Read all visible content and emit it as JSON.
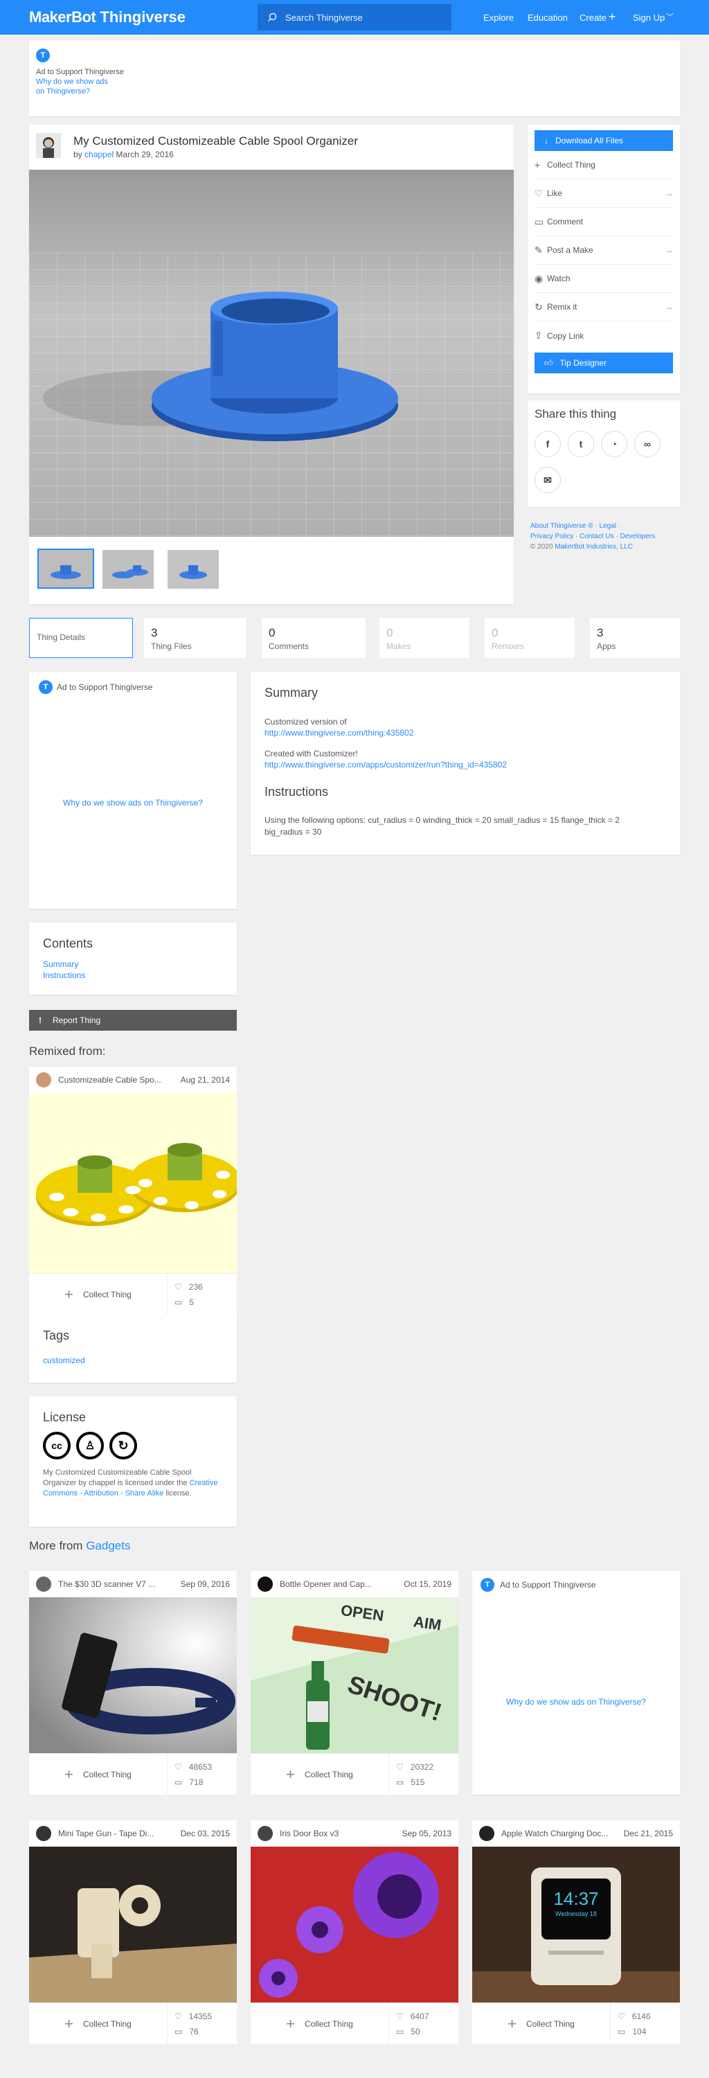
{
  "header": {
    "logo_maker": "MakerBot",
    "logo_thing": "Thingiverse",
    "search_placeholder": "Search Thingiverse",
    "nav": [
      "Explore",
      "Education",
      "Create",
      "Sign Up"
    ]
  },
  "ad_top": {
    "title": "Ad to Support Thingiverse",
    "why_1": "Why do we show ads",
    "why_2": "on Thingiverse?"
  },
  "thing": {
    "title": "My Customized Customizeable Cable Spool Organizer",
    "by": "by",
    "author": "chappel",
    "date": "March 29, 2016"
  },
  "actions": {
    "download": "Download All Files",
    "collect": "Collect Thing",
    "like": "Like",
    "comment": "Comment",
    "post_make": "Post a Make",
    "watch": "Watch",
    "remix": "Remix it",
    "copy_link": "Copy Link",
    "tip": "Tip Designer"
  },
  "share": {
    "title": "Share this thing"
  },
  "footer_links": {
    "about": "About Thingiverse ®",
    "legal": "Legal",
    "privacy": "Privacy Policy",
    "contact": "Contact Us",
    "developers": "Developers",
    "copyright": "© 2020",
    "company": "MakerBot Industries, LLC"
  },
  "tabs": [
    {
      "n": "",
      "l": "Thing Details"
    },
    {
      "n": "3",
      "l": "Thing Files"
    },
    {
      "n": "0",
      "l": "Comments"
    },
    {
      "n": "0",
      "l": "Makes"
    },
    {
      "n": "0",
      "l": "Remixes"
    },
    {
      "n": "3",
      "l": "Apps"
    }
  ],
  "ad_side": {
    "title": "Ad to Support Thingiverse",
    "why": "Why do we show ads on Thingiverse?"
  },
  "summary": {
    "heading": "Summary",
    "line1": "Customized version of",
    "link1": "http://www.thingiverse.com/thing:435802",
    "line2": "Created with Customizer!",
    "link2": "http://www.thingiverse.com/apps/customizer/run?thing_id=435802",
    "instr_heading": "Instructions",
    "instr_text": "Using the following options: cut_radius = 0 winding_thick = 20 small_radius = 15 flange_thick = 2 big_radius = 30"
  },
  "contents": {
    "heading": "Contents",
    "items": [
      "Summary",
      "Instructions"
    ]
  },
  "report": "Report Thing",
  "remixed_from": {
    "heading": "Remixed from:",
    "title": "Customizeable Cable Spo...",
    "date": "Aug 21, 2014",
    "collect": "Collect Thing",
    "likes": "236",
    "comments": "5"
  },
  "tags": {
    "heading": "Tags",
    "items": [
      "customized"
    ]
  },
  "license": {
    "heading": "License",
    "text_1": "My Customized Customizeable Cable Spool Organizer by chappel is licensed under the",
    "link": "Creative Commons - Attribution - Share Alike",
    "text_2": "license."
  },
  "more": {
    "prefix": "More from",
    "category": "Gadgets"
  },
  "cards": [
    {
      "title": "The $30 3D scanner V7 ...",
      "date": "Sep 09, 2016",
      "collect": "Collect Thing",
      "likes": "48653",
      "comments": "718"
    },
    {
      "title": "Bottle Opener and Cap...",
      "date": "Oct 15, 2019",
      "collect": "Collect Thing",
      "likes": "20322",
      "comments": "515",
      "img_text_1": "OPEN",
      "img_text_2": "AIM",
      "img_text_3": "SHOOT!"
    },
    {
      "title": "Mini Tape Gun - Tape Di...",
      "date": "Dec 03, 2015",
      "collect": "Collect Thing",
      "likes": "14355",
      "comments": "76"
    },
    {
      "title": "Iris Door Box v3",
      "date": "Sep 05, 2013",
      "collect": "Collect Thing",
      "likes": "6407",
      "comments": "50"
    },
    {
      "title": "Apple Watch Charging Doc...",
      "date": "Dec 21, 2015",
      "collect": "Collect Thing",
      "likes": "6146",
      "comments": "104",
      "watch_time": "14:37",
      "watch_day": "Wednesday 18"
    }
  ],
  "ad_card": {
    "title": "Ad to Support Thingiverse",
    "why": "Why do we show ads on Thingiverse?"
  }
}
